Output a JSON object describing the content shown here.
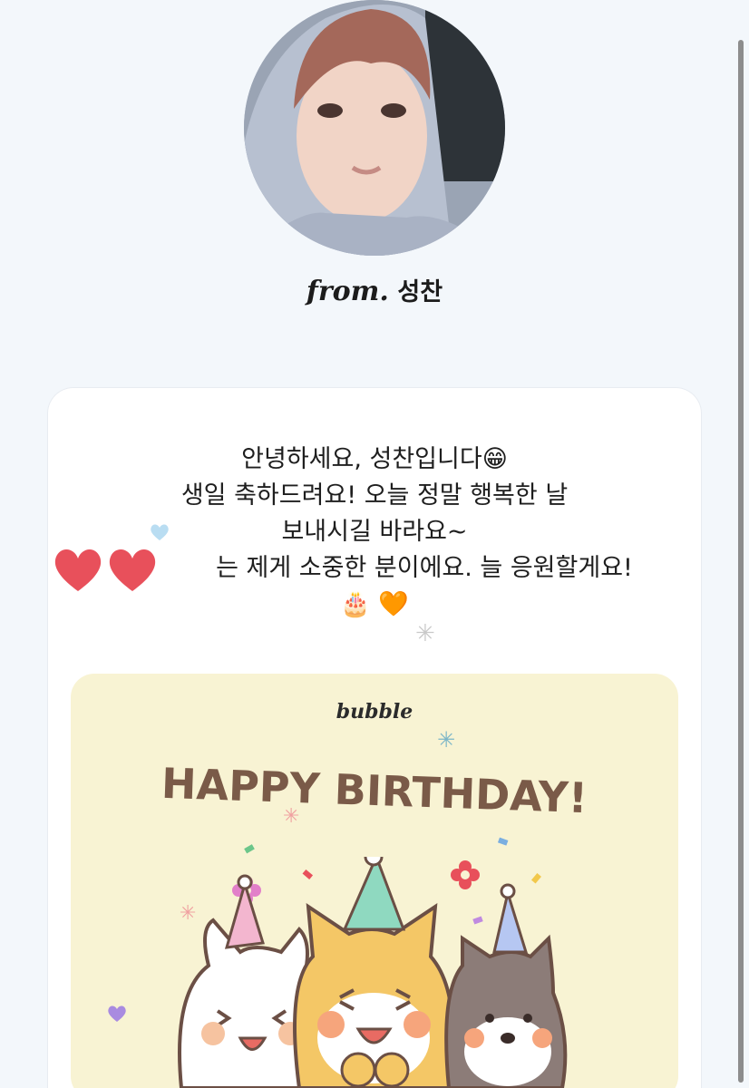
{
  "sender": {
    "from_label": "from.",
    "name": "성찬"
  },
  "message": {
    "lines": [
      "안녕하세요, 성찬입니다😁",
      "생일 축하드려요! 오늘 정말 행복한 날",
      "보내시길 바라요~",
      "는 제게 소중한 분이에요. 늘 응원할게요!",
      "🎂 🧡"
    ]
  },
  "card": {
    "brand": "bubble",
    "title": "HAPPY BIRTHDAY!"
  },
  "colors": {
    "page_bg": "#f3f7fb",
    "card_bg": "#ffffff",
    "birthday_card_bg": "#f8f3d3",
    "title_color": "#7a5a48",
    "heart_sticker": "#e8505b"
  },
  "icons": [
    "grin-emoji",
    "cake-emoji",
    "orange-heart-emoji",
    "heart-sticker",
    "sparkle"
  ]
}
